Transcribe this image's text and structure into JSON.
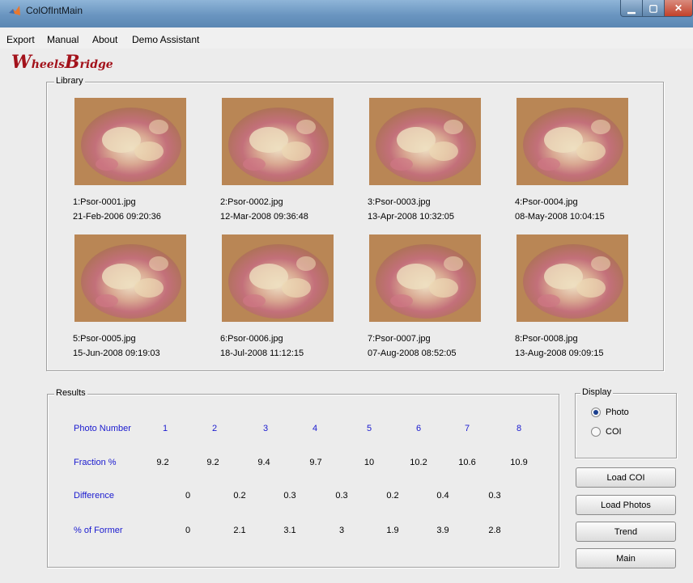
{
  "window": {
    "title": "ColOfIntMain"
  },
  "menu": [
    "Export",
    "Manual",
    "About",
    "Demo Assistant"
  ],
  "logo": {
    "text_w": "W",
    "text_heels": "heels",
    "text_b": "B",
    "text_ridge": "ridge"
  },
  "library": {
    "label": "Library",
    "photos": [
      {
        "name": "1:Psor-0001.jpg",
        "date": "21-Feb-2006 09:20:36"
      },
      {
        "name": "2:Psor-0002.jpg",
        "date": "12-Mar-2008 09:36:48"
      },
      {
        "name": "3:Psor-0003.jpg",
        "date": "13-Apr-2008 10:32:05"
      },
      {
        "name": "4:Psor-0004.jpg",
        "date": "08-May-2008 10:04:15"
      },
      {
        "name": "5:Psor-0005.jpg",
        "date": "15-Jun-2008 09:19:03"
      },
      {
        "name": "6:Psor-0006.jpg",
        "date": "18-Jul-2008 11:12:15"
      },
      {
        "name": "7:Psor-0007.jpg",
        "date": "07-Aug-2008 08:52:05"
      },
      {
        "name": "8:Psor-0008.jpg",
        "date": "13-Aug-2008 09:09:15"
      }
    ]
  },
  "results": {
    "label": "Results",
    "photo_number_label": "Photo Number",
    "fraction_label": "Fraction %",
    "difference_label": "Difference",
    "pct_former_label": "% of Former",
    "photo_numbers": [
      "1",
      "2",
      "3",
      "4",
      "5",
      "6",
      "7",
      "8"
    ],
    "fraction": [
      "9.2",
      "9.2",
      "9.4",
      "9.7",
      "10",
      "10.2",
      "10.6",
      "10.9"
    ],
    "difference": [
      "0",
      "0.2",
      "0.3",
      "0.3",
      "0.2",
      "0.4",
      "0.3"
    ],
    "pct_former": [
      "0",
      "2.1",
      "3.1",
      "3",
      "1.9",
      "3.9",
      "2.8"
    ]
  },
  "display": {
    "label": "Display",
    "options": [
      {
        "label": "Photo",
        "selected": true
      },
      {
        "label": "COI",
        "selected": false
      }
    ]
  },
  "buttons": {
    "load_coi": "Load COI",
    "load_photos": "Load Photos",
    "trend": "Trend",
    "main": "Main"
  },
  "colors": {
    "link_blue": "#1a1acf",
    "logo_red": "#a3121b"
  }
}
